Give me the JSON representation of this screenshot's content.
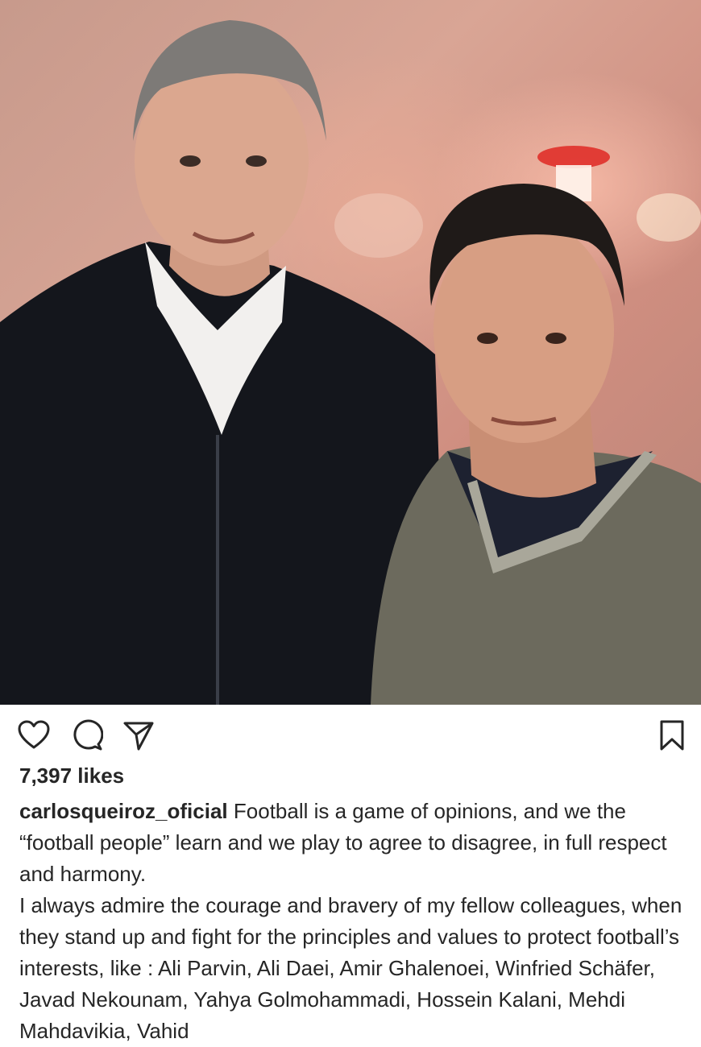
{
  "post": {
    "image_alt": "Two men posing together in a warmly lit room",
    "likes": "7,397 likes",
    "username": "carlosqueiroz_oficial",
    "caption_first": "Football is a game of opinions, and we the “football people” learn and we play to agree to disagree, in full respect and harmony.",
    "caption_second": "I always admire the courage and bravery of my fellow colleagues, when they stand up and fight for the principles and values to protect football’s interests, like : Ali Parvin, Ali Daei, Amir Ghalenoei, Winfried Schäfer, Javad Nekounam, Yahya Golmohammadi, Hossein Kalani, Mehdi Mahdavikia, Vahid"
  },
  "icons": {
    "like": "heart-icon",
    "comment": "comment-icon",
    "share": "send-icon",
    "save": "bookmark-icon"
  },
  "colors": {
    "text": "#262626",
    "background": "#ffffff"
  }
}
